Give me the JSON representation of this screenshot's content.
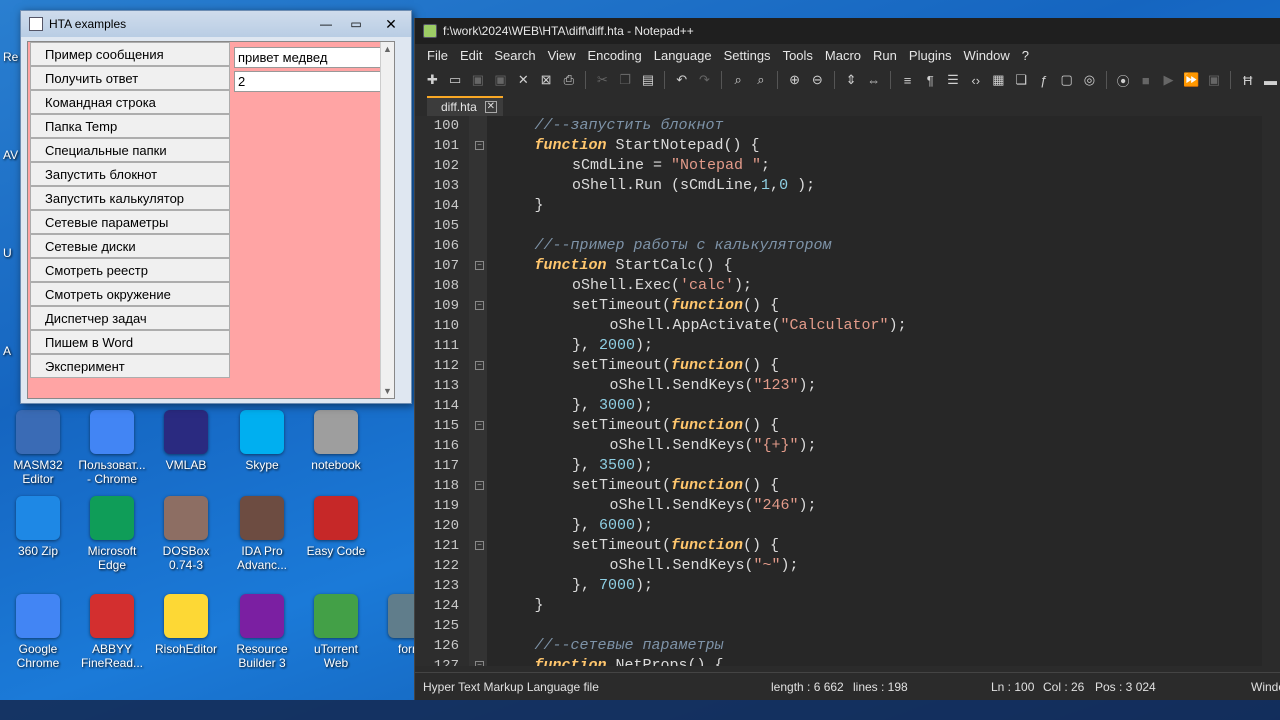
{
  "desktop": {
    "left_strip": [
      "Re",
      "AV",
      "U",
      "A"
    ],
    "icons": [
      {
        "label": "MASM32\nEditor",
        "icon": "masm-icon",
        "color": "#3a6bb5"
      },
      {
        "label": "Пользоват...\n- Chrome",
        "icon": "chrome-user-icon",
        "color": "#4285f4"
      },
      {
        "label": "VMLAB",
        "icon": "vmlab-icon",
        "color": "#2a2a80"
      },
      {
        "label": "Skype",
        "icon": "skype-icon",
        "color": "#00aff0"
      },
      {
        "label": "notebook",
        "icon": "notebook-icon",
        "color": "#9e9e9e"
      },
      {
        "label": "360 Zip",
        "icon": "zip-icon",
        "color": "#1e88e5"
      },
      {
        "label": "Microsoft\nEdge",
        "icon": "edge-icon",
        "color": "#0f9d58"
      },
      {
        "label": "DOSBox\n0.74-3",
        "icon": "dosbox-icon",
        "color": "#8d6e63"
      },
      {
        "label": "IDA Pro\nAdvanc...",
        "icon": "ida-icon",
        "color": "#6d4c41"
      },
      {
        "label": "Easy Code",
        "icon": "easycode-icon",
        "color": "#c62828"
      },
      {
        "label": "Google\nChrome",
        "icon": "chrome-icon",
        "color": "#4285f4"
      },
      {
        "label": "ABBYY\nFineRead...",
        "icon": "abbyy-icon",
        "color": "#d32f2f"
      },
      {
        "label": "RisohEditor",
        "icon": "risoh-icon",
        "color": "#fdd835"
      },
      {
        "label": "Resource\nBuilder 3",
        "icon": "resource-icon",
        "color": "#7b1fa2"
      },
      {
        "label": "uTorrent\nWeb",
        "icon": "utorrent-icon",
        "color": "#43a047"
      },
      {
        "label": "form",
        "icon": "form-icon",
        "color": "#607d8b"
      }
    ]
  },
  "hta": {
    "title": "HTA examples",
    "buttons": [
      "Пример сообщения",
      "Получить ответ",
      "Командная строка",
      "Папка Temp",
      "Специальные папки",
      "Запустить блокнот",
      "Запустить калькулятор",
      "Сетевые параметры",
      "Сетевые диски",
      "Смотреть реестр",
      "Смотреть окружение",
      "Диспетчер задач",
      "Пишем в Word",
      "Эксперимент"
    ],
    "input1_value": "привет медвед",
    "input2_value": "2",
    "win_min": "—",
    "win_max": "▭",
    "win_close": "✕",
    "scroll_up": "▲",
    "scroll_down": "▼",
    "bg_color": "#ffa4a4"
  },
  "npp": {
    "title": "f:\\work\\2024\\WEB\\HTA\\diff\\diff.hta - Notepad++",
    "menu": [
      "File",
      "Edit",
      "Search",
      "View",
      "Encoding",
      "Language",
      "Settings",
      "Tools",
      "Macro",
      "Run",
      "Plugins",
      "Window",
      "?"
    ],
    "tab": "diff.hta",
    "tab_close": "✕",
    "fold_open": "−",
    "lines": [
      {
        "n": "100",
        "fold": false,
        "indent": 1,
        "tokens": [
          [
            "cm",
            "//--запустить блокнот"
          ]
        ]
      },
      {
        "n": "101",
        "fold": true,
        "indent": 1,
        "tokens": [
          [
            "kw",
            "function"
          ],
          [
            "id",
            " StartNotepad() {"
          ]
        ]
      },
      {
        "n": "102",
        "fold": false,
        "indent": 2,
        "tokens": [
          [
            "id",
            "sCmdLine = "
          ],
          [
            "str",
            "\"Notepad \""
          ],
          [
            "id",
            ";"
          ]
        ]
      },
      {
        "n": "103",
        "fold": false,
        "indent": 2,
        "tokens": [
          [
            "id",
            "oShell.Run (sCmdLine,"
          ],
          [
            "num",
            "1"
          ],
          [
            "id",
            ","
          ],
          [
            "num",
            "0"
          ],
          [
            "id",
            " );"
          ]
        ]
      },
      {
        "n": "104",
        "fold": false,
        "indent": 1,
        "tokens": [
          [
            "id",
            "}"
          ]
        ]
      },
      {
        "n": "105",
        "fold": false,
        "indent": 0,
        "tokens": []
      },
      {
        "n": "106",
        "fold": false,
        "indent": 1,
        "tokens": [
          [
            "cm",
            "//--пример работы с калькулятором"
          ]
        ]
      },
      {
        "n": "107",
        "fold": true,
        "indent": 1,
        "tokens": [
          [
            "kw",
            "function"
          ],
          [
            "id",
            " StartCalc() {"
          ]
        ]
      },
      {
        "n": "108",
        "fold": false,
        "indent": 2,
        "tokens": [
          [
            "id",
            "oShell.Exec("
          ],
          [
            "str",
            "'calc'"
          ],
          [
            "id",
            ");"
          ]
        ]
      },
      {
        "n": "109",
        "fold": true,
        "indent": 2,
        "tokens": [
          [
            "id",
            "setTimeout("
          ],
          [
            "kw",
            "function"
          ],
          [
            "id",
            "() {"
          ]
        ]
      },
      {
        "n": "110",
        "fold": false,
        "indent": 3,
        "tokens": [
          [
            "id",
            "oShell.AppActivate("
          ],
          [
            "str",
            "\"Calculator\""
          ],
          [
            "id",
            ");"
          ]
        ]
      },
      {
        "n": "111",
        "fold": false,
        "indent": 2,
        "tokens": [
          [
            "id",
            "}, "
          ],
          [
            "num",
            "2000"
          ],
          [
            "id",
            ");"
          ]
        ]
      },
      {
        "n": "112",
        "fold": true,
        "indent": 2,
        "tokens": [
          [
            "id",
            "setTimeout("
          ],
          [
            "kw",
            "function"
          ],
          [
            "id",
            "() {"
          ]
        ]
      },
      {
        "n": "113",
        "fold": false,
        "indent": 3,
        "tokens": [
          [
            "id",
            "oShell.SendKeys("
          ],
          [
            "str",
            "\"123\""
          ],
          [
            "id",
            ");"
          ]
        ]
      },
      {
        "n": "114",
        "fold": false,
        "indent": 2,
        "tokens": [
          [
            "id",
            "}, "
          ],
          [
            "num",
            "3000"
          ],
          [
            "id",
            ");"
          ]
        ]
      },
      {
        "n": "115",
        "fold": true,
        "indent": 2,
        "tokens": [
          [
            "id",
            "setTimeout("
          ],
          [
            "kw",
            "function"
          ],
          [
            "id",
            "() {"
          ]
        ]
      },
      {
        "n": "116",
        "fold": false,
        "indent": 3,
        "tokens": [
          [
            "id",
            "oShell.SendKeys("
          ],
          [
            "str",
            "\"{+}\""
          ],
          [
            "id",
            ");"
          ]
        ]
      },
      {
        "n": "117",
        "fold": false,
        "indent": 2,
        "tokens": [
          [
            "id",
            "}, "
          ],
          [
            "num",
            "3500"
          ],
          [
            "id",
            ");"
          ]
        ]
      },
      {
        "n": "118",
        "fold": true,
        "indent": 2,
        "tokens": [
          [
            "id",
            "setTimeout("
          ],
          [
            "kw",
            "function"
          ],
          [
            "id",
            "() {"
          ]
        ]
      },
      {
        "n": "119",
        "fold": false,
        "indent": 3,
        "tokens": [
          [
            "id",
            "oShell.SendKeys("
          ],
          [
            "str",
            "\"246\""
          ],
          [
            "id",
            ");"
          ]
        ]
      },
      {
        "n": "120",
        "fold": false,
        "indent": 2,
        "tokens": [
          [
            "id",
            "}, "
          ],
          [
            "num",
            "6000"
          ],
          [
            "id",
            ");"
          ]
        ]
      },
      {
        "n": "121",
        "fold": true,
        "indent": 2,
        "tokens": [
          [
            "id",
            "setTimeout("
          ],
          [
            "kw",
            "function"
          ],
          [
            "id",
            "() {"
          ]
        ]
      },
      {
        "n": "122",
        "fold": false,
        "indent": 3,
        "tokens": [
          [
            "id",
            "oShell.SendKeys("
          ],
          [
            "str",
            "\"~\""
          ],
          [
            "id",
            ");"
          ]
        ]
      },
      {
        "n": "123",
        "fold": false,
        "indent": 2,
        "tokens": [
          [
            "id",
            "}, "
          ],
          [
            "num",
            "7000"
          ],
          [
            "id",
            ");"
          ]
        ]
      },
      {
        "n": "124",
        "fold": false,
        "indent": 1,
        "tokens": [
          [
            "id",
            "}"
          ]
        ]
      },
      {
        "n": "125",
        "fold": false,
        "indent": 0,
        "tokens": []
      },
      {
        "n": "126",
        "fold": false,
        "indent": 1,
        "tokens": [
          [
            "cm",
            "//--сетевые параметры"
          ]
        ]
      },
      {
        "n": "127",
        "fold": true,
        "indent": 1,
        "tokens": [
          [
            "kw",
            "function"
          ],
          [
            "id",
            " NetProps() {"
          ]
        ]
      }
    ],
    "status": {
      "lang": "Hyper Text Markup Language file",
      "length": "length : 6 662",
      "lines": "lines : 198",
      "ln": "Ln : 100",
      "col": "Col : 26",
      "pos": "Pos : 3 024",
      "eol": "Windo"
    },
    "colors": {
      "comment": "#7e93a8",
      "keyword": "#ffc66d",
      "string": "#e39b8a",
      "number": "#8fcfe3"
    }
  }
}
